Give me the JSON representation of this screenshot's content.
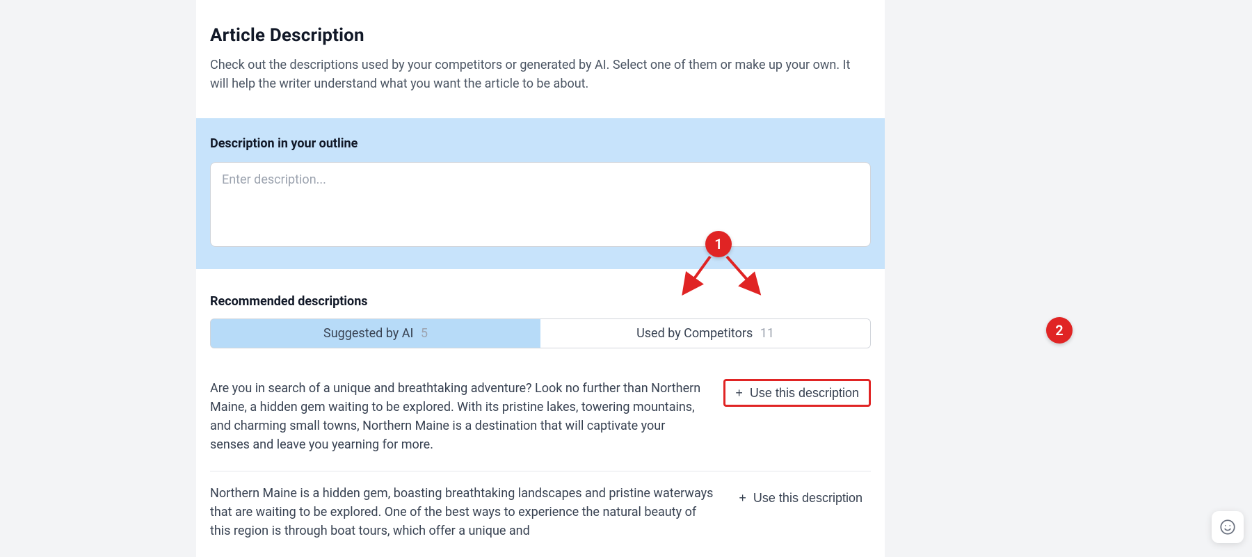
{
  "header": {
    "title": "Article Description",
    "subtitle": "Check out the descriptions used by your competitors or generated by AI. Select one of them or make up your own. It will help the writer understand what you want the article to be about."
  },
  "outline": {
    "label": "Description in your outline",
    "placeholder": "Enter description..."
  },
  "recommended": {
    "label": "Recommended descriptions",
    "tabs": {
      "ai": {
        "label": "Suggested by AI",
        "count": "5"
      },
      "comp": {
        "label": "Used by Competitors",
        "count": "11"
      }
    },
    "use_label": "Use this description",
    "items": [
      "Are you in search of a unique and breathtaking adventure? Look no further than Northern Maine, a hidden gem waiting to be explored. With its pristine lakes, towering mountains, and charming small towns, Northern Maine is a destination that will captivate your senses and leave you yearning for more.",
      "Northern Maine is a hidden gem, boasting breathtaking landscapes and pristine waterways that are waiting to be explored. One of the best ways to experience the natural beauty of this region is through boat tours, which offer a unique and"
    ]
  },
  "annotations": {
    "one": "1",
    "two": "2"
  }
}
